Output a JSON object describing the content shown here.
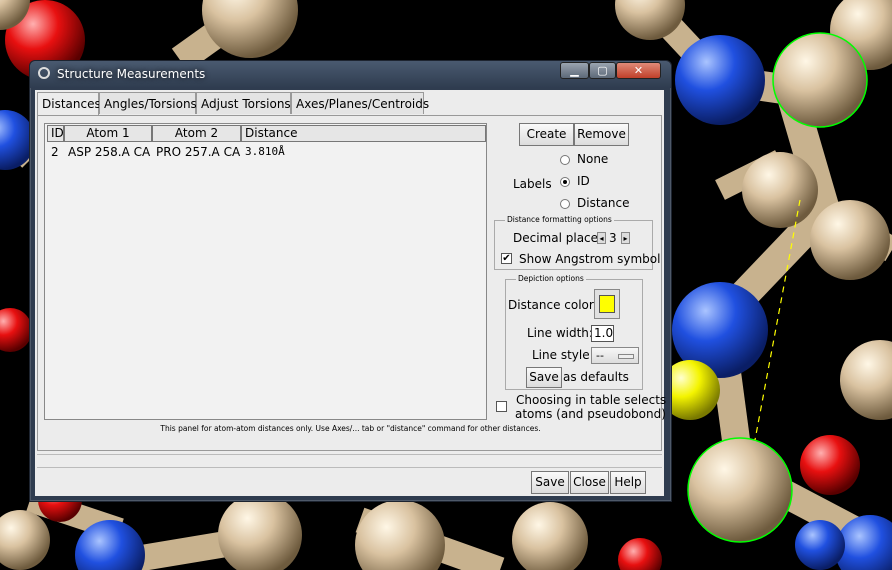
{
  "window": {
    "title": "Structure Measurements",
    "controls": {
      "minimize": "▁",
      "maximize": "▢",
      "close": "✕"
    }
  },
  "tabs": [
    {
      "label": "Distances",
      "active": true
    },
    {
      "label": "Angles/Torsions",
      "active": false
    },
    {
      "label": "Adjust Torsions",
      "active": false
    },
    {
      "label": "Axes/Planes/Centroids",
      "active": false
    }
  ],
  "table": {
    "columns": [
      "ID",
      "Atom 1",
      "Atom 2",
      "Distance"
    ],
    "rows": [
      {
        "id": "2",
        "atom1": "ASP 258.A CA",
        "atom2": "PRO 257.A CA",
        "distance": "3.810Å"
      }
    ]
  },
  "footnote": "This panel for atom-atom distances only.  Use Axes/... tab or \"distance\" command for other distances.",
  "actions": {
    "create": "Create",
    "remove": "Remove"
  },
  "labels": {
    "caption": "Labels",
    "options": [
      {
        "label": "None",
        "selected": false
      },
      {
        "label": "ID",
        "selected": true
      },
      {
        "label": "Distance",
        "selected": false
      }
    ]
  },
  "formatting": {
    "group_label": "Distance formatting options",
    "decimal_places_label": "Decimal places",
    "decimal_places": "3",
    "show_angstrom_label": "Show Angstrom symbol",
    "show_angstrom": true
  },
  "depiction": {
    "group_label": "Depiction options",
    "color_label": "Distance color:",
    "color": "#ffff00",
    "line_width_label": "Line width:",
    "line_width": "1.0",
    "line_style_label": "Line style:",
    "line_style": "--",
    "save_label": "Save",
    "save_suffix": "as defaults"
  },
  "choosing": {
    "label_line1": "Choosing in table selects",
    "label_line2": "atoms (and pseudobond)",
    "checked": false
  },
  "bottom_buttons": {
    "save": "Save",
    "close": "Close",
    "help": "Help"
  },
  "colors": {
    "titlebar": "#2f3c4f",
    "window_bg": "#ececec",
    "carbon": "#d2b48c",
    "nitrogen": "#1f4fd6",
    "oxygen": "#e01010",
    "sulfur": "#ffff00",
    "selection": "#00ff00"
  }
}
